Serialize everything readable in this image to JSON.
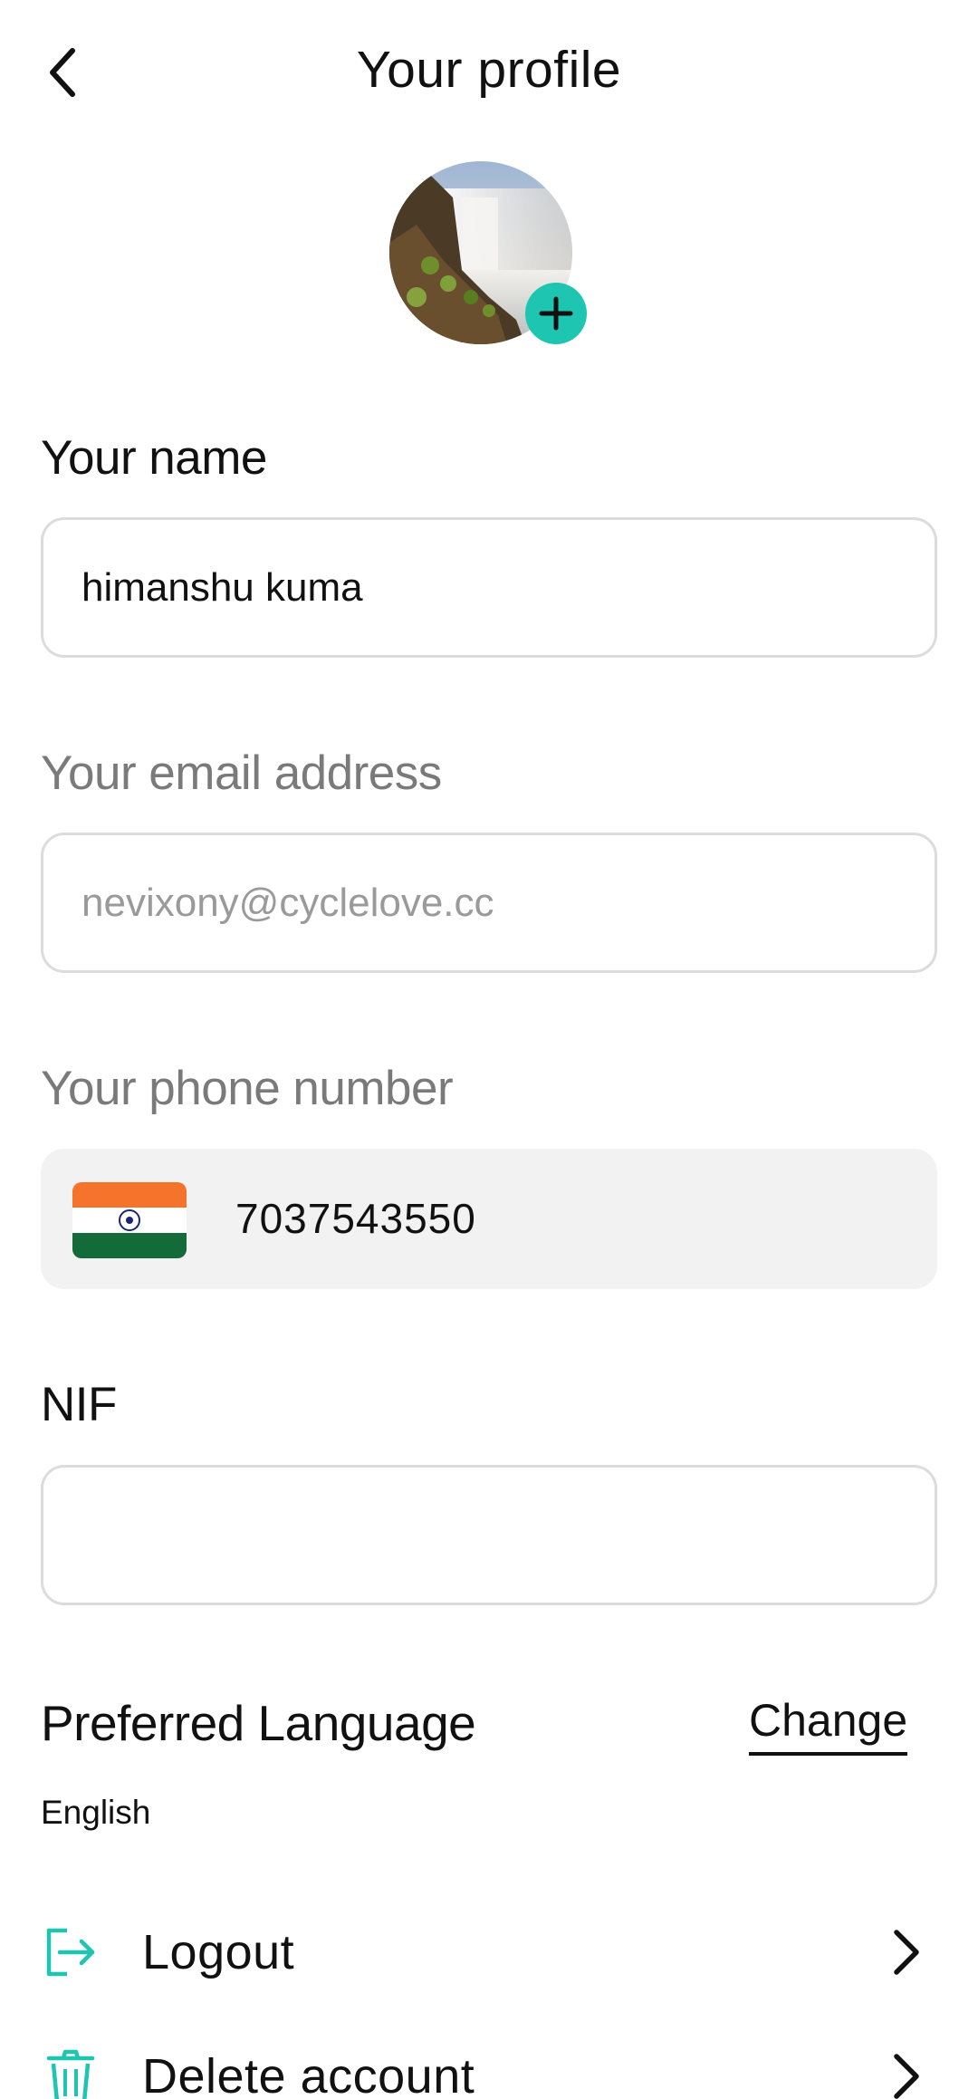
{
  "header": {
    "title": "Your profile",
    "back_icon": "chevron-left-icon"
  },
  "avatar": {
    "add_icon": "plus-icon",
    "accent": "#1ec5b1"
  },
  "fields": {
    "name": {
      "label": "Your name",
      "value": "himanshu kuma"
    },
    "email": {
      "label": "Your email address",
      "placeholder": "nevixony@cyclelove.cc"
    },
    "phone": {
      "label": "Your phone number",
      "country_flag": "india-flag-icon",
      "value": "7037543550"
    },
    "nif": {
      "label": "NIF",
      "value": ""
    }
  },
  "language": {
    "title": "Preferred Language",
    "change_label": "Change",
    "value": "English"
  },
  "menu": {
    "logout": {
      "label": "Logout",
      "icon": "logout-icon"
    },
    "delete": {
      "label": "Delete account",
      "icon": "trash-icon"
    }
  },
  "colors": {
    "accent": "#1ec5b1",
    "muted_label": "#7a7a7a",
    "border": "#dcdcdc",
    "phone_bg": "#f2f2f2"
  }
}
